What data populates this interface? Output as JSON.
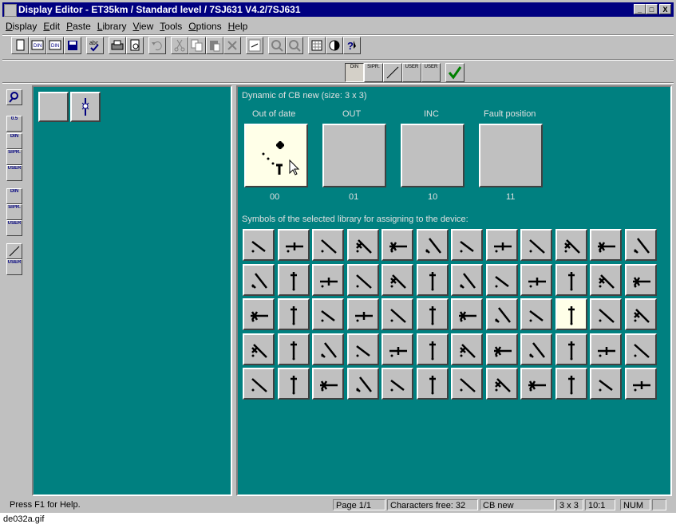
{
  "window": {
    "title": "Display Editor - ET35km / Standard level / 7SJ631 V4.2/7SJ631"
  },
  "caption_buttons": [
    "_",
    "□",
    "X"
  ],
  "menu": [
    "Display",
    "Edit",
    "Paste",
    "Library",
    "View",
    "Tools",
    "Options",
    "Help"
  ],
  "toolbar_icons": [
    "new-icon",
    "din-open-icon",
    "din-save-icon",
    "save-icon",
    "spellcheck-icon",
    "print-icon",
    "print-preview-icon",
    "undo-icon",
    "cut-icon",
    "copy-icon",
    "paste-icon",
    "delete-icon",
    "symbol-icon",
    "zoom-in-icon",
    "zoom-out-icon",
    "grid-icon",
    "contrast-icon",
    "help-icon"
  ],
  "library_toolbar": {
    "din": "DIN",
    "sipr": "SIPR.",
    "user": "USER"
  },
  "left_tools": {
    "scale": "0.5",
    "din": "DIN",
    "sipr": "SIPR.",
    "user": "USER"
  },
  "dynamic": {
    "heading": "Dynamic of CB new (size: 3 x 3)",
    "states": [
      {
        "label": "Out of date",
        "code": "00"
      },
      {
        "label": "OUT",
        "code": "01"
      },
      {
        "label": "INC",
        "code": "10"
      },
      {
        "label": "Fault position",
        "code": "11"
      }
    ]
  },
  "symbols_heading": "Symbols of the selected library for assigning to the device:",
  "symbols": {
    "rows": 5,
    "cols": 12,
    "selected_row": 2,
    "selected_col": 9
  },
  "status": {
    "help": "Press F1 for Help.",
    "page": "Page 1/1",
    "chars": "Characters free: 32",
    "object": "CB new",
    "size": "3 x 3",
    "zoom": "10:1",
    "num": "NUM"
  },
  "figure_caption": "de032a.gif",
  "colors": {
    "panel": "#008080",
    "titlebar": "#000080",
    "face": "#c0c0c0",
    "selected": "#ffffe8"
  }
}
